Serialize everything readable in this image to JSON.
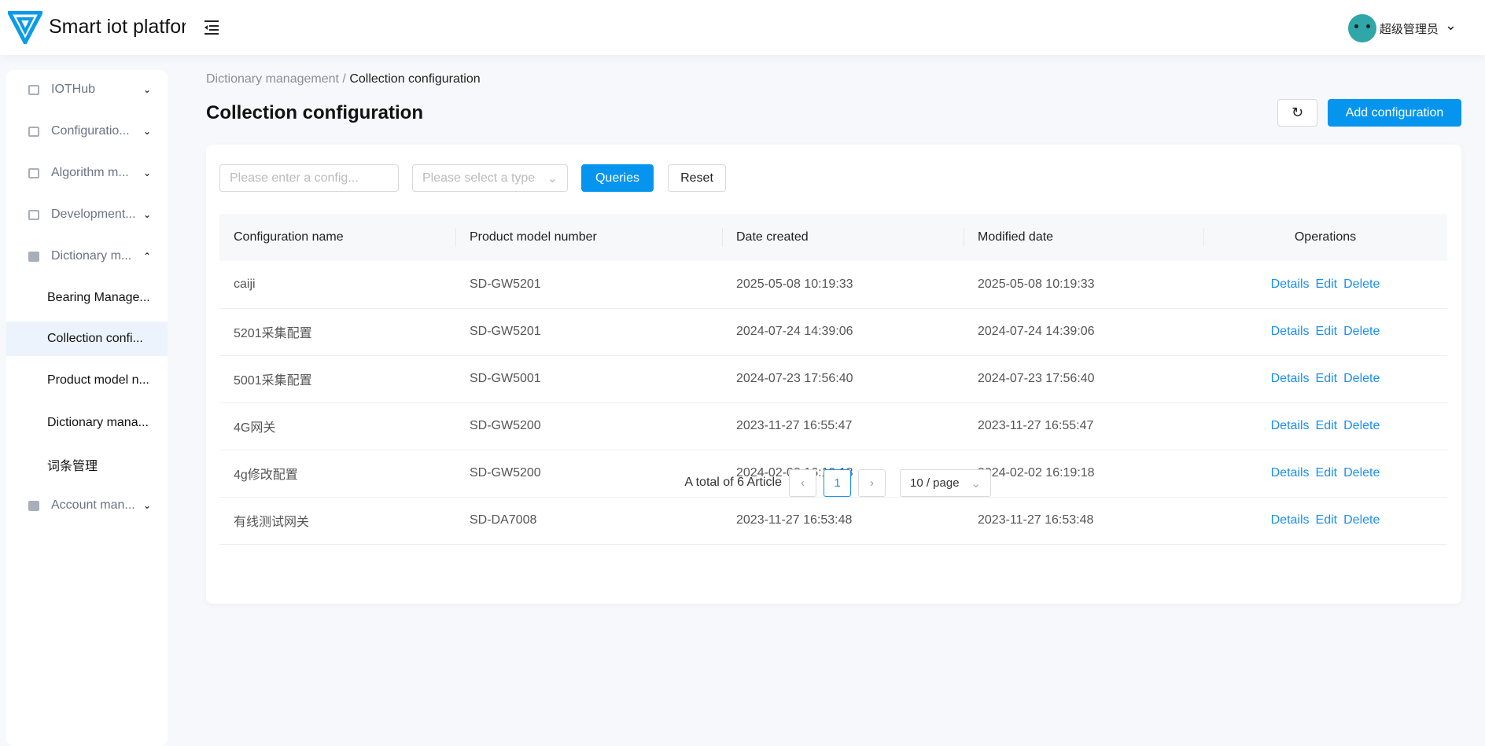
{
  "app": {
    "brand": "Smart iot platfor",
    "user": "超级管理员"
  },
  "sidebar": {
    "items": [
      {
        "label": "IOTHub",
        "expanded": false
      },
      {
        "label": "Configuratio...",
        "expanded": false
      },
      {
        "label": "Algorithm m...",
        "expanded": false
      },
      {
        "label": "Development...",
        "expanded": false
      },
      {
        "label": "Dictionary m...",
        "expanded": true
      },
      {
        "label": "Account man...",
        "expanded": false
      }
    ],
    "subitems": [
      {
        "label": "Bearing Manage..."
      },
      {
        "label": "Collection confi...",
        "active": true
      },
      {
        "label": "Product model n..."
      },
      {
        "label": "Dictionary mana..."
      },
      {
        "label": "词条管理"
      }
    ]
  },
  "breadcrumb": {
    "parent": "Dictionary management",
    "sep": "/",
    "current": "Collection configuration"
  },
  "page": {
    "title": "Collection configuration",
    "add_label": "Add configuration",
    "refresh_icon": "refresh-icon"
  },
  "filters": {
    "name_placeholder": "Please enter a config...",
    "type_placeholder": "Please select a type",
    "query_label": "Queries",
    "reset_label": "Reset"
  },
  "table": {
    "columns": [
      "Configuration name",
      "Product model number",
      "Date created",
      "Modified date",
      "Operations"
    ],
    "actions": [
      "Details",
      "Edit",
      "Delete"
    ],
    "rows": [
      [
        "caiji",
        "SD-GW5201",
        "2025-05-08 10:19:33",
        "2025-05-08 10:19:33"
      ],
      [
        "5201采集配置",
        "SD-GW5201",
        "2024-07-24 14:39:06",
        "2024-07-24 14:39:06"
      ],
      [
        "5001采集配置",
        "SD-GW5001",
        "2024-07-23 17:56:40",
        "2024-07-23 17:56:40"
      ],
      [
        "4G网关",
        "SD-GW5200",
        "2023-11-27 16:55:47",
        "2023-11-27 16:55:47"
      ],
      [
        "4g修改配置",
        "SD-GW5200",
        "2024-02-02 16:19:18",
        "2024-02-02 16:19:18"
      ],
      [
        "有线测试网关",
        "SD-DA7008",
        "2023-11-27 16:53:48",
        "2023-11-27 16:53:48"
      ]
    ]
  },
  "pagination": {
    "total_text": "A total of 6 Article",
    "current": "1",
    "page_size": "10 / page"
  }
}
